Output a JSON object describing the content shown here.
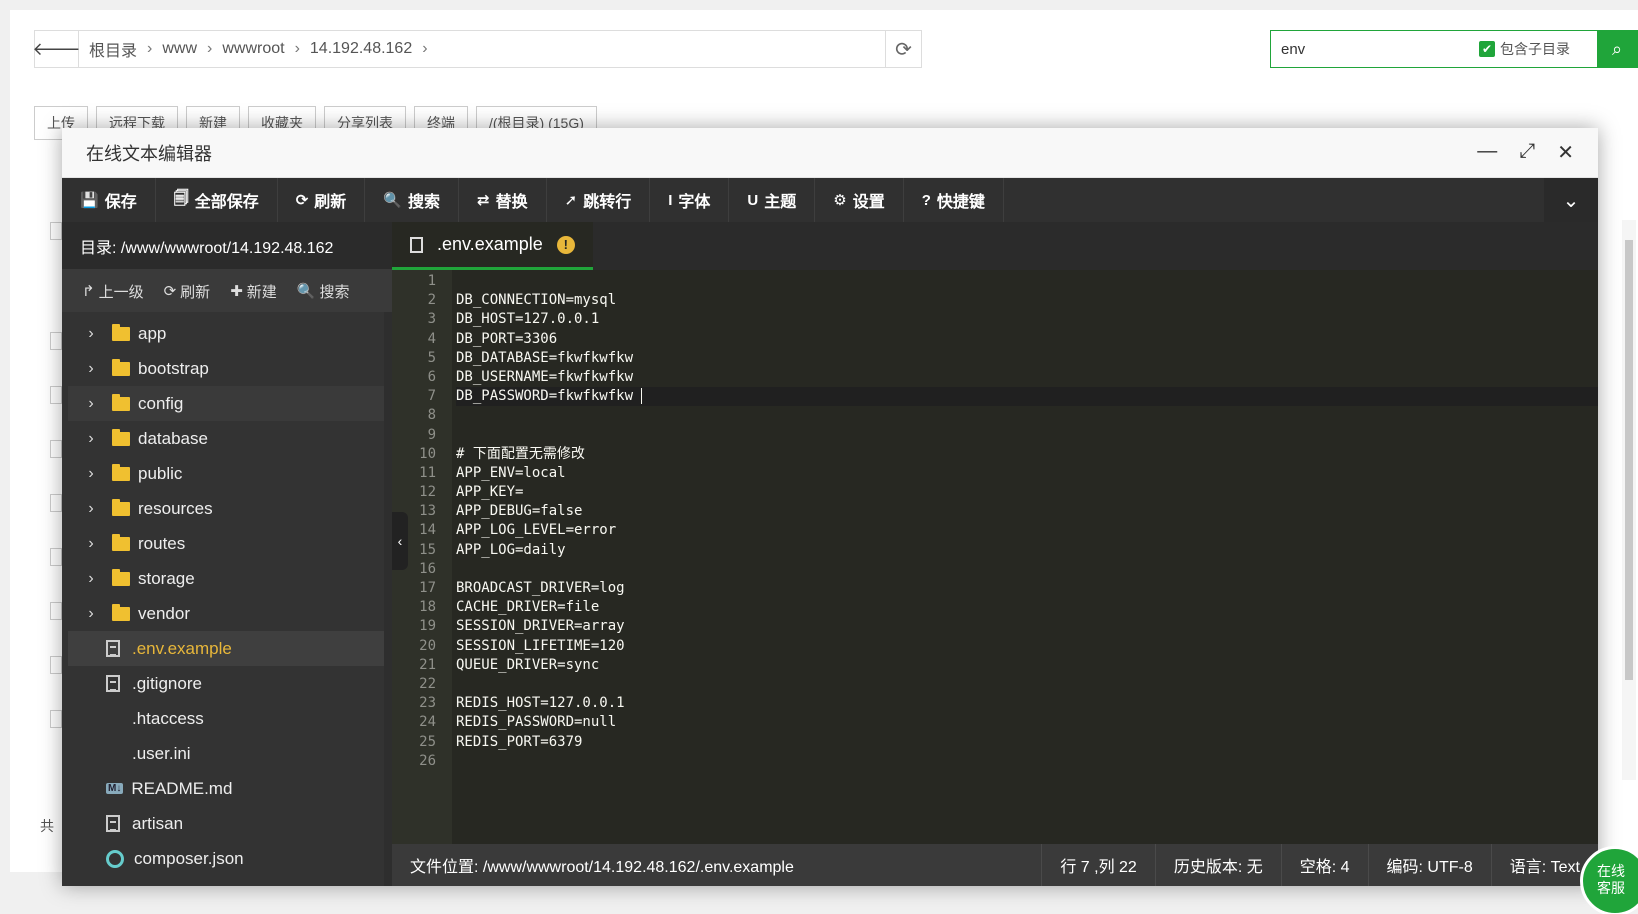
{
  "address_bar": {
    "crumbs": [
      "根目录",
      "www",
      "wwwroot",
      "14.192.48.162"
    ]
  },
  "search": {
    "value": "env",
    "include_subdir_label": "包含子目录"
  },
  "bg_toolbar": [
    "上传",
    "远程下载",
    "新建",
    "收藏夹",
    "分享列表",
    "终端",
    "/(根目录) (15G)"
  ],
  "editor": {
    "title": "在线文本编辑器",
    "toolbar": [
      {
        "icon": "save-icon",
        "glyph": "💾",
        "label": "保存"
      },
      {
        "icon": "save-all-icon",
        "glyph": "🗐",
        "label": "全部保存"
      },
      {
        "icon": "refresh-icon",
        "glyph": "⟳",
        "label": "刷新"
      },
      {
        "icon": "search-icon",
        "glyph": "🔍",
        "label": "搜索"
      },
      {
        "icon": "replace-icon",
        "glyph": "⇄",
        "label": "替换"
      },
      {
        "icon": "goto-line-icon",
        "glyph": "➚",
        "label": "跳转行"
      },
      {
        "icon": "font-icon",
        "glyph": "I",
        "label": "字体"
      },
      {
        "icon": "theme-icon",
        "glyph": "U",
        "label": "主题"
      },
      {
        "icon": "settings-icon",
        "glyph": "⚙",
        "label": "设置"
      },
      {
        "icon": "help-icon",
        "glyph": "?",
        "label": "快捷键"
      }
    ],
    "sidebar": {
      "directory_label": "目录: /www/wwwroot/14.192.48.162",
      "actions": [
        {
          "glyph": "↱",
          "label": "上一级"
        },
        {
          "glyph": "⟳",
          "label": "刷新"
        },
        {
          "glyph": "✚",
          "label": "新建"
        },
        {
          "glyph": "🔍",
          "label": "搜索"
        }
      ],
      "tree": [
        {
          "name": "app",
          "type": "folder"
        },
        {
          "name": "bootstrap",
          "type": "folder"
        },
        {
          "name": "config",
          "type": "folder"
        },
        {
          "name": "database",
          "type": "folder"
        },
        {
          "name": "public",
          "type": "folder"
        },
        {
          "name": "resources",
          "type": "folder"
        },
        {
          "name": "routes",
          "type": "folder"
        },
        {
          "name": "storage",
          "type": "folder"
        },
        {
          "name": "vendor",
          "type": "folder"
        },
        {
          "name": ".env.example",
          "type": "file",
          "active": true
        },
        {
          "name": ".gitignore",
          "type": "file"
        },
        {
          "name": ".htaccess",
          "type": "blank"
        },
        {
          "name": ".user.ini",
          "type": "blank"
        },
        {
          "name": "README.md",
          "type": "md"
        },
        {
          "name": "artisan",
          "type": "file"
        },
        {
          "name": "composer.json",
          "type": "composer"
        }
      ]
    },
    "tab": {
      "filename": ".env.example",
      "warning": "!"
    },
    "code_lines": [
      "",
      "DB_CONNECTION=mysql",
      "DB_HOST=127.0.0.1",
      "DB_PORT=3306",
      "DB_DATABASE=fkwfkwfkw",
      "DB_USERNAME=fkwfkwfkw",
      "DB_PASSWORD=fkwfkwfkw",
      "",
      "",
      "# 下面配置无需修改",
      "APP_ENV=local",
      "APP_KEY=",
      "APP_DEBUG=false",
      "APP_LOG_LEVEL=error",
      "APP_LOG=daily",
      "",
      "BROADCAST_DRIVER=log",
      "CACHE_DRIVER=file",
      "SESSION_DRIVER=array",
      "SESSION_LIFETIME=120",
      "QUEUE_DRIVER=sync",
      "",
      "REDIS_HOST=127.0.0.1",
      "REDIS_PASSWORD=null",
      "REDIS_PORT=6379",
      ""
    ],
    "current_line": 7,
    "status": {
      "path": "文件位置: /www/wwwroot/14.192.48.162/.env.example",
      "position": "行 7 ,列 22",
      "history": "历史版本: 无",
      "indent": "空格: 4",
      "encoding": "编码: UTF-8",
      "language": "语言: Text"
    }
  },
  "bg_count": "共",
  "online_service": "在线\n客服"
}
